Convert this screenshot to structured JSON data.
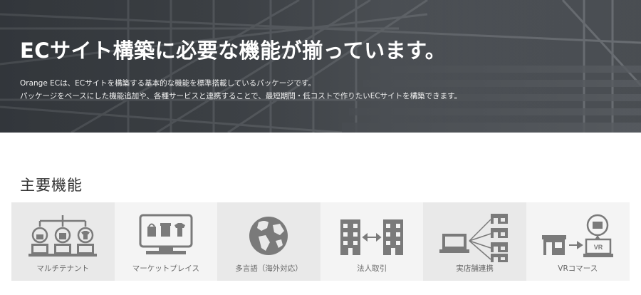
{
  "hero": {
    "title": "ECサイト構築に必要な機能が揃っています。",
    "desc_line1": "Orange ECは、ECサイトを構築する基本的な機能を標準搭載しているパッケージです。",
    "desc_line2": "パッケージをベースにした機能追加や、各種サービスと連携することで、最短期間・低コストで作りたいECサイトを構築できます。"
  },
  "section": {
    "title": "主要機能"
  },
  "features": [
    {
      "label": "マルチテナント",
      "icon": "multi-tenant-icon"
    },
    {
      "label": "マーケットプレイス",
      "icon": "marketplace-icon"
    },
    {
      "label": "多言語（海外対応）",
      "icon": "globe-icon"
    },
    {
      "label": "法人取引",
      "icon": "b2b-buildings-icon"
    },
    {
      "label": "実店舗連携",
      "icon": "store-link-icon"
    },
    {
      "label": "VRコマース",
      "icon": "vr-commerce-icon"
    }
  ],
  "colors": {
    "icon": "#7a7a7a",
    "tile_dark": "#e9e9e9",
    "tile_light": "#f4f4f4"
  }
}
